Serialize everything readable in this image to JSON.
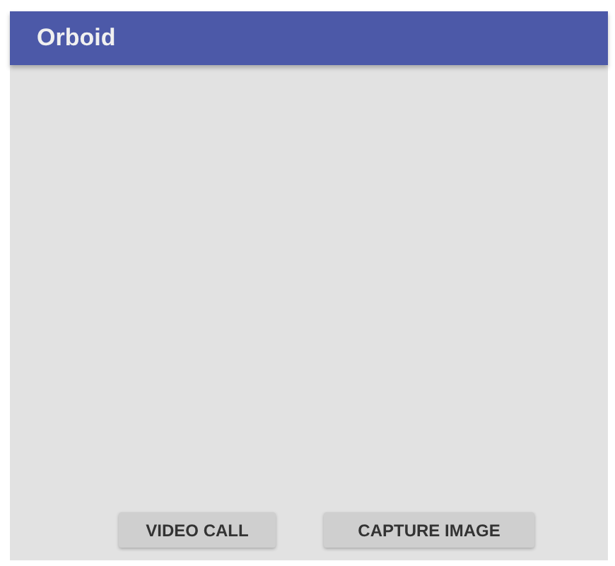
{
  "app_bar": {
    "title": "Orboid"
  },
  "buttons": [
    {
      "label": "VIDEO CALL"
    },
    {
      "label": "CAPTURE IMAGE"
    }
  ]
}
